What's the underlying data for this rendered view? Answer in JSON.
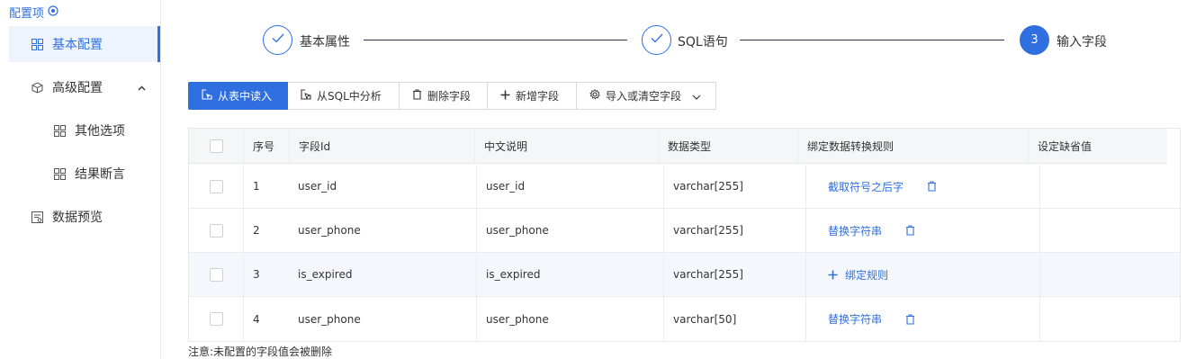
{
  "sidebar": {
    "title": "配置项",
    "items": [
      {
        "label": "基本配置",
        "icon": "grid-icon",
        "active": true
      },
      {
        "label": "高级配置",
        "icon": "cube-icon",
        "expanded": true
      },
      {
        "label": "其他选项",
        "icon": "grid-icon"
      },
      {
        "label": "结果断言",
        "icon": "grid-icon"
      },
      {
        "label": "数据预览",
        "icon": "preview-icon"
      }
    ]
  },
  "steps": [
    {
      "label": "基本属性",
      "status": "done"
    },
    {
      "label": "SQL语句",
      "status": "done"
    },
    {
      "label": "输入字段",
      "status": "current",
      "number": "3"
    }
  ],
  "toolbar": {
    "read_from_table": "从表中读入",
    "analyze_sql": "从SQL中分析",
    "delete_field": "删除字段",
    "add_field": "新增字段",
    "import_clear": "导入或清空字段"
  },
  "table": {
    "headers": [
      "序号",
      "字段Id",
      "中文说明",
      "数据类型",
      "绑定数据转换规则",
      "设定缺省值"
    ],
    "rows": [
      {
        "no": "1",
        "field_id": "user_id",
        "desc": "user_id",
        "type": "varchar[255]",
        "rule": "截取符号之后字",
        "rule_kind": "link"
      },
      {
        "no": "2",
        "field_id": "user_phone",
        "desc": "user_phone",
        "type": "varchar[255]",
        "rule": "替换字符串",
        "rule_kind": "link"
      },
      {
        "no": "3",
        "field_id": "is_expired",
        "desc": "is_expired",
        "type": "varchar[255]",
        "rule": "绑定规则",
        "rule_kind": "bind"
      },
      {
        "no": "4",
        "field_id": "user_phone",
        "desc": "user_phone",
        "type": "varchar[50]",
        "rule": "替换字符串",
        "rule_kind": "link"
      }
    ]
  },
  "note": "注意:未配置的字段值会被删除",
  "colors": {
    "accent": "#2f6fe0",
    "header_bg": "#f5f6f8",
    "row_highlight": "#f4f8fd"
  }
}
